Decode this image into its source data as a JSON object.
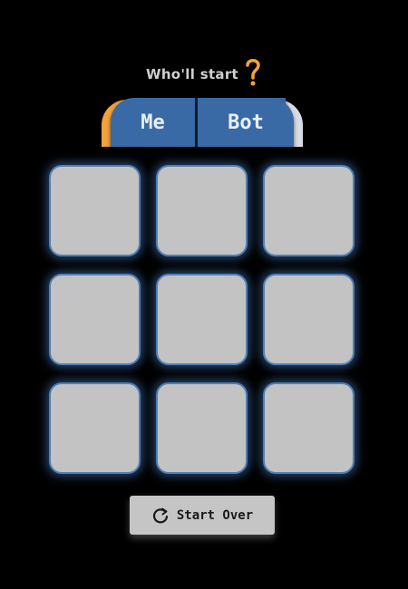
{
  "prompt": {
    "text": "Who'll start",
    "icon": "question-mark-icon",
    "icon_color": "#f3a23a"
  },
  "chooser": {
    "options": [
      {
        "label": "Me",
        "accent": "#f3a23a"
      },
      {
        "label": "Bot",
        "accent": "#d9dce3"
      }
    ],
    "button_color": "#3a6aa6"
  },
  "board": {
    "rows": 3,
    "cols": 3,
    "cells": [
      "",
      "",
      "",
      "",
      "",
      "",
      "",
      "",
      ""
    ],
    "cell_color": "#c3c3c3",
    "glow_color": "#4f7fb5"
  },
  "restart": {
    "label": "Start Over",
    "icon": "refresh-icon"
  }
}
